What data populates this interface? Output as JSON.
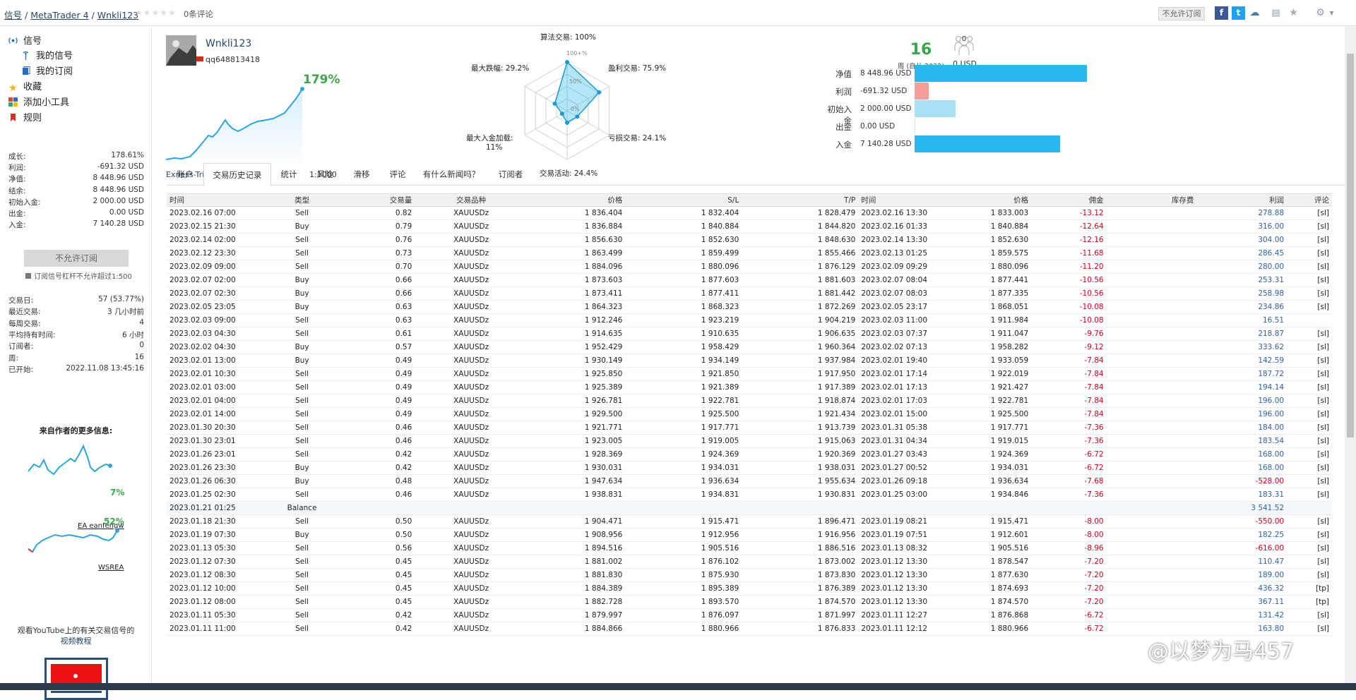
{
  "breadcrumb": {
    "signals": "信号",
    "platform": "MetaTrader 4",
    "name": "Wnkli123",
    "reviews": "0条评论"
  },
  "top": {
    "no_subscribe": "不允许订阅"
  },
  "sidebar": {
    "nav": {
      "signals": "信号",
      "my_signals": "我的信号",
      "my_subscriptions": "我的订阅",
      "favorites": "收藏",
      "add_widget": "添加小工具",
      "rules": "规则"
    },
    "stats": [
      {
        "k": "成长:",
        "v": "178.61%"
      },
      {
        "k": "利润:",
        "v": "-691.32 USD"
      },
      {
        "k": "净值:",
        "v": "8 448.96 USD"
      },
      {
        "k": "结余:",
        "v": "8 448.96 USD"
      },
      {
        "k": "初始入金:",
        "v": "2 000.00 USD"
      },
      {
        "k": "出金:",
        "v": "0.00 USD"
      },
      {
        "k": "入金:",
        "v": "7 140.28 USD"
      }
    ],
    "no_subscribe": "不允许订阅",
    "note": "订阅信号杠杆不允许超过1:500",
    "stats2": [
      {
        "k": "交易日:",
        "v": "57 (53.77%)"
      },
      {
        "k": "最近交易:",
        "v": "3 几小时前"
      },
      {
        "k": "每周交易:",
        "v": "4"
      },
      {
        "k": "平均持有时间:",
        "v": "6 小时"
      },
      {
        "k": "订阅者:",
        "v": "0"
      },
      {
        "k": "周:",
        "v": "16"
      },
      {
        "k": "已开始:",
        "v": "2022.11.08 13:45:16"
      }
    ],
    "more_title": "来自作者的更多信息:",
    "more": [
      {
        "pct": "7%",
        "name": "EA eanfengw"
      },
      {
        "pct": "52%",
        "name": "WSREA"
      }
    ],
    "yt_text": "观看YouTube上的有关交易信号的",
    "yt_link": "视频教程"
  },
  "profile": {
    "name": "Wnkli123",
    "id": "qq648813418",
    "growth": "179%",
    "broker": "Exness-Trial7",
    "leverage": "1:1000"
  },
  "radar": {
    "labels": {
      "algo": "算法交易: 100%",
      "profit": "盈利交易: 75.9%",
      "loss": "亏损交易: 24.1%",
      "activity": "交易活动: 24.4%",
      "maxload": "最大入金加载:",
      "maxload_v": "11%",
      "drawdown": "最大跌幅: 29.2%"
    },
    "grid": {
      "g100": "100+%",
      "g50": "50%",
      "g0": "0%"
    },
    "values": [
      1.0,
      0.759,
      0.241,
      0.244,
      0.11,
      0.292
    ]
  },
  "summary": {
    "weeks": "16",
    "weeks_label": "周 (自从 2022)",
    "subs_count": "0",
    "subs_usd": "0 USD",
    "bars": [
      {
        "label": "净值",
        "value": "8 448.96 USD",
        "amount": 8448.96,
        "color": "#29b7ef"
      },
      {
        "label": "利润",
        "value": "-691.32 USD",
        "amount": 691.32,
        "color": "#f59c9c"
      },
      {
        "label": "初始入金",
        "value": "2 000.00 USD",
        "amount": 2000,
        "color": "#a8e0f8"
      },
      {
        "label": "出金",
        "value": "0.00 USD",
        "amount": 0,
        "color": "#29b7ef"
      },
      {
        "label": "入金",
        "value": "7 140.28 USD",
        "amount": 7140.28,
        "color": "#29b7ef"
      }
    ]
  },
  "tabs": [
    "账户",
    "交易历史记录",
    "统计",
    "风险",
    "滑移",
    "评论",
    "有什么新闻吗？",
    "订阅者"
  ],
  "table": {
    "headers": [
      "时间",
      "类型",
      "交易量",
      "交易品种",
      "价格",
      "S/L",
      "T/P",
      "时间",
      "价格",
      "佣金",
      "库存费",
      "利润",
      "评论"
    ],
    "rows": [
      [
        "2023.02.16 07:00",
        "Sell",
        "0.82",
        "XAUUSDz",
        "1 836.404",
        "1 832.404",
        "1 828.479",
        "2023.02.16 13:30",
        "1 833.003",
        "-13.12",
        "",
        "278.88",
        "[sl]"
      ],
      [
        "2023.02.15 21:30",
        "Buy",
        "0.79",
        "XAUUSDz",
        "1 836.884",
        "1 840.884",
        "1 844.820",
        "2023.02.16 01:33",
        "1 840.884",
        "-12.64",
        "",
        "316.00",
        "[sl]"
      ],
      [
        "2023.02.14 02:00",
        "Sell",
        "0.76",
        "XAUUSDz",
        "1 856.630",
        "1 852.630",
        "1 848.630",
        "2023.02.14 13:30",
        "1 852.630",
        "-12.16",
        "",
        "304.00",
        "[sl]"
      ],
      [
        "2023.02.12 23:30",
        "Sell",
        "0.73",
        "XAUUSDz",
        "1 863.499",
        "1 859.499",
        "1 855.466",
        "2023.02.13 01:25",
        "1 859.575",
        "-11.68",
        "",
        "286.45",
        "[sl]"
      ],
      [
        "2023.02.09 09:00",
        "Sell",
        "0.70",
        "XAUUSDz",
        "1 884.096",
        "1 880.096",
        "1 876.129",
        "2023.02.09 09:29",
        "1 880.096",
        "-11.20",
        "",
        "280.00",
        "[sl]"
      ],
      [
        "2023.02.07 02:00",
        "Buy",
        "0.66",
        "XAUUSDz",
        "1 873.603",
        "1 877.603",
        "1 881.603",
        "2023.02.07 08:04",
        "1 877.441",
        "-10.56",
        "",
        "253.31",
        "[sl]"
      ],
      [
        "2023.02.07 02:30",
        "Buy",
        "0.66",
        "XAUUSDz",
        "1 873.411",
        "1 877.411",
        "1 881.442",
        "2023.02.07 08:03",
        "1 877.335",
        "-10.56",
        "",
        "258.98",
        "[sl]"
      ],
      [
        "2023.02.05 23:05",
        "Buy",
        "0.63",
        "XAUUSDz",
        "1 864.323",
        "1 868.323",
        "1 872.269",
        "2023.02.05 23:17",
        "1 868.051",
        "-10.08",
        "",
        "234.86",
        "[sl]"
      ],
      [
        "2023.02.03 09:00",
        "Sell",
        "0.63",
        "XAUUSDz",
        "1 912.246",
        "1 923.219",
        "1 904.219",
        "2023.02.03 11:00",
        "1 911.984",
        "-10.08",
        "",
        "16.51",
        ""
      ],
      [
        "2023.02.03 04:30",
        "Sell",
        "0.61",
        "XAUUSDz",
        "1 914.635",
        "1 910.635",
        "1 906.635",
        "2023.02.03 07:37",
        "1 911.047",
        "-9.76",
        "",
        "218.87",
        "[sl]"
      ],
      [
        "2023.02.02 04:30",
        "Buy",
        "0.57",
        "XAUUSDz",
        "1 952.429",
        "1 958.429",
        "1 960.364",
        "2023.02.02 07:13",
        "1 958.282",
        "-9.12",
        "",
        "333.62",
        "[sl]"
      ],
      [
        "2023.02.01 13:00",
        "Buy",
        "0.49",
        "XAUUSDz",
        "1 930.149",
        "1 934.149",
        "1 937.984",
        "2023.02.01 19:40",
        "1 933.059",
        "-7.84",
        "",
        "142.59",
        "[sl]"
      ],
      [
        "2023.02.01 10:30",
        "Sell",
        "0.49",
        "XAUUSDz",
        "1 925.850",
        "1 921.850",
        "1 917.950",
        "2023.02.01 17:14",
        "1 922.019",
        "-7.84",
        "",
        "187.72",
        "[sl]"
      ],
      [
        "2023.02.01 03:00",
        "Sell",
        "0.49",
        "XAUUSDz",
        "1 925.389",
        "1 921.389",
        "1 917.389",
        "2023.02.01 17:13",
        "1 921.427",
        "-7.84",
        "",
        "194.14",
        "[sl]"
      ],
      [
        "2023.02.01 04:00",
        "Sell",
        "0.49",
        "XAUUSDz",
        "1 926.781",
        "1 922.781",
        "1 918.874",
        "2023.02.01 17:03",
        "1 922.781",
        "-7.84",
        "",
        "196.00",
        "[sl]"
      ],
      [
        "2023.02.01 14:00",
        "Sell",
        "0.49",
        "XAUUSDz",
        "1 929.500",
        "1 925.500",
        "1 921.434",
        "2023.02.01 15:00",
        "1 925.500",
        "-7.84",
        "",
        "196.00",
        "[sl]"
      ],
      [
        "2023.01.30 20:30",
        "Sell",
        "0.46",
        "XAUUSDz",
        "1 921.771",
        "1 917.771",
        "1 913.739",
        "2023.01.31 05:38",
        "1 917.771",
        "-7.36",
        "",
        "184.00",
        "[sl]"
      ],
      [
        "2023.01.30 23:01",
        "Sell",
        "0.46",
        "XAUUSDz",
        "1 923.005",
        "1 919.005",
        "1 915.063",
        "2023.01.31 04:34",
        "1 919.015",
        "-7.36",
        "",
        "183.54",
        "[sl]"
      ],
      [
        "2023.01.26 23:01",
        "Sell",
        "0.42",
        "XAUUSDz",
        "1 928.369",
        "1 924.369",
        "1 920.369",
        "2023.01.27 03:43",
        "1 924.369",
        "-6.72",
        "",
        "168.00",
        "[sl]"
      ],
      [
        "2023.01.26 23:30",
        "Buy",
        "0.42",
        "XAUUSDz",
        "1 930.031",
        "1 934.031",
        "1 938.031",
        "2023.01.27 00:52",
        "1 934.031",
        "-6.72",
        "",
        "168.00",
        "[sl]"
      ],
      [
        "2023.01.26 06:30",
        "Buy",
        "0.48",
        "XAUUSDz",
        "1 947.634",
        "1 936.634",
        "1 955.634",
        "2023.01.26 09:18",
        "1 936.634",
        "-7.68",
        "",
        "-528.00",
        "[sl]"
      ],
      [
        "2023.01.25 02:30",
        "Sell",
        "0.46",
        "XAUUSDz",
        "1 938.831",
        "1 934.831",
        "1 930.831",
        "2023.01.25 03:00",
        "1 934.846",
        "-7.36",
        "",
        "183.31",
        "[sl]"
      ],
      [
        "2023.01.21 01:25",
        "Balance",
        "",
        "",
        "",
        "",
        "",
        "",
        "",
        "",
        "",
        "3 541.52",
        ""
      ],
      [
        "2023.01.18 21:30",
        "Sell",
        "0.50",
        "XAUUSDz",
        "1 904.471",
        "1 915.471",
        "1 896.471",
        "2023.01.19 08:21",
        "1 915.471",
        "-8.00",
        "",
        "-550.00",
        "[sl]"
      ],
      [
        "2023.01.19 07:30",
        "Buy",
        "0.50",
        "XAUUSDz",
        "1 908.956",
        "1 912.956",
        "1 916.956",
        "2023.01.19 07:51",
        "1 912.601",
        "-8.00",
        "",
        "182.25",
        "[sl]"
      ],
      [
        "2023.01.13 05:30",
        "Sell",
        "0.56",
        "XAUUSDz",
        "1 894.516",
        "1 905.516",
        "1 886.516",
        "2023.01.13 08:32",
        "1 905.516",
        "-8.96",
        "",
        "-616.00",
        "[sl]"
      ],
      [
        "2023.01.12 07:30",
        "Sell",
        "0.45",
        "XAUUSDz",
        "1 881.002",
        "1 876.102",
        "1 873.002",
        "2023.01.12 13:30",
        "1 878.547",
        "-7.20",
        "",
        "110.47",
        "[sl]"
      ],
      [
        "2023.01.12 08:30",
        "Sell",
        "0.45",
        "XAUUSDz",
        "1 881.830",
        "1 875.930",
        "1 873.830",
        "2023.01.12 13:30",
        "1 877.630",
        "-7.20",
        "",
        "189.00",
        "[sl]"
      ],
      [
        "2023.01.12 10:00",
        "Sell",
        "0.45",
        "XAUUSDz",
        "1 884.389",
        "1 895.389",
        "1 876.389",
        "2023.01.12 13:30",
        "1 874.693",
        "-7.20",
        "",
        "436.32",
        "[tp]"
      ],
      [
        "2023.01.12 08:00",
        "Sell",
        "0.45",
        "XAUUSDz",
        "1 882.728",
        "1 893.570",
        "1 874.570",
        "2023.01.12 13:30",
        "1 874.570",
        "-7.20",
        "",
        "367.11",
        "[tp]"
      ],
      [
        "2023.01.11 05:30",
        "Sell",
        "0.42",
        "XAUUSDz",
        "1 879.997",
        "1 876.097",
        "1 871.997",
        "2023.01.11 12:27",
        "1 876.868",
        "-6.72",
        "",
        "131.42",
        "[sl]"
      ],
      [
        "2023.01.11 11:00",
        "Sell",
        "0.42",
        "XAUUSDz",
        "1 884.866",
        "1 880.966",
        "1 876.833",
        "2023.01.11 12:12",
        "1 880.966",
        "-6.72",
        "",
        "163.80",
        "[sl]"
      ]
    ]
  },
  "watermark": "@以梦为马457"
}
